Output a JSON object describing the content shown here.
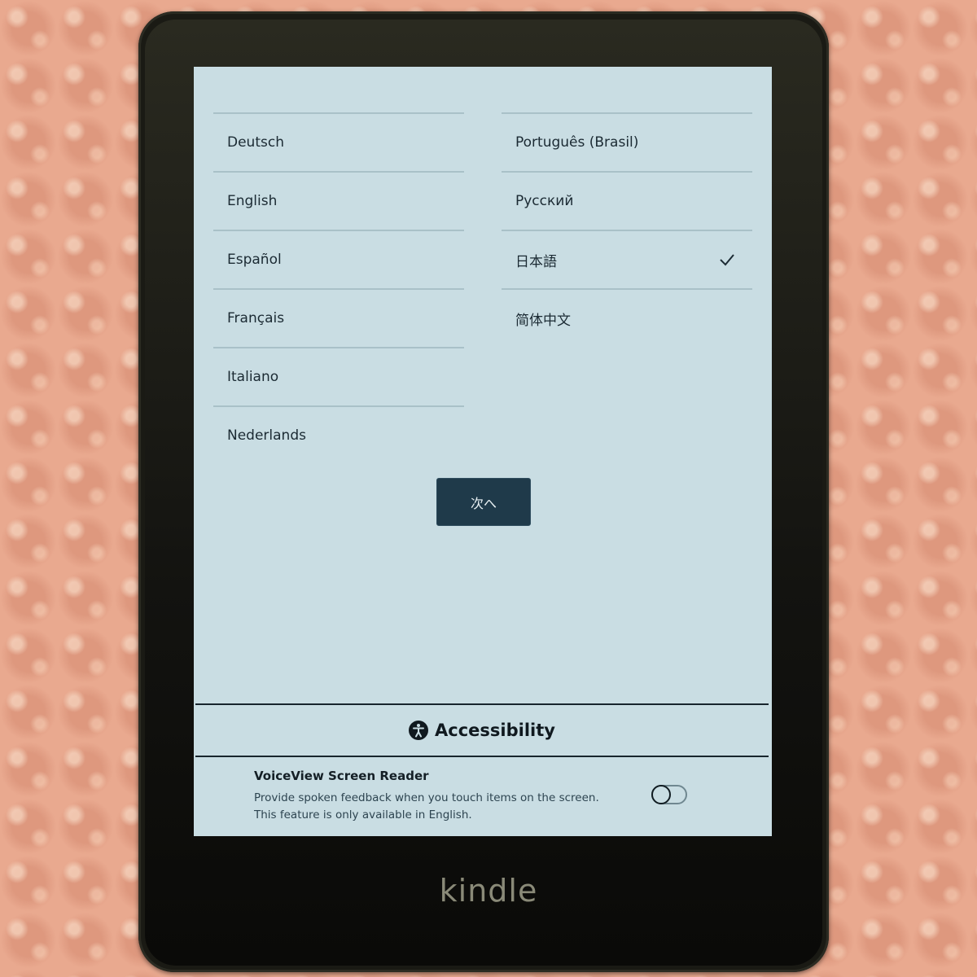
{
  "device": {
    "brand": "kindle"
  },
  "language_list": {
    "left_column": [
      {
        "label": "Deutsch",
        "selected": false
      },
      {
        "label": "English",
        "selected": false
      },
      {
        "label": "Español",
        "selected": false
      },
      {
        "label": "Français",
        "selected": false
      },
      {
        "label": "Italiano",
        "selected": false
      },
      {
        "label": "Nederlands",
        "selected": false
      }
    ],
    "right_column": [
      {
        "label": "Português (Brasil)",
        "selected": false
      },
      {
        "label": "Русский",
        "selected": false
      },
      {
        "label": "日本語",
        "selected": true
      },
      {
        "label": "简体中文",
        "selected": false
      }
    ]
  },
  "next_button": {
    "label": "次へ"
  },
  "accessibility": {
    "title": "Accessibility",
    "icon": "accessibility-icon",
    "voiceview": {
      "title": "VoiceView Screen Reader",
      "description_line1": "Provide spoken feedback when you touch items on the screen.",
      "description_line2": "This feature is only available in English.",
      "enabled": false
    }
  },
  "colors": {
    "screen_bg": "#c9dde3",
    "button_bg": "#1f3a4a",
    "text": "#1b2a33",
    "bezel": "#1a1a14"
  }
}
